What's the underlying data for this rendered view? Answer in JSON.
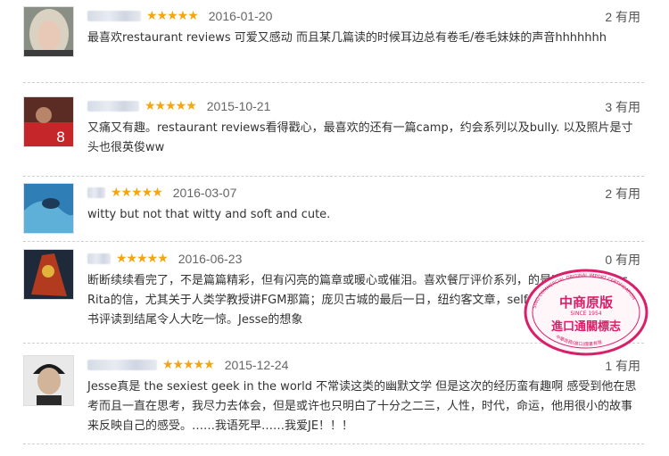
{
  "reviews": [
    {
      "stars": "★★★★★",
      "date": "2016-01-20",
      "helpful": "2 有用",
      "text": "最喜欢restaurant reviews 可爱又感动 而且某几篇读的时候耳边总有卷毛/卷毛妹妹的声音hhhhhhh"
    },
    {
      "stars": "★★★★★",
      "date": "2015-10-21",
      "helpful": "3 有用",
      "text": "又痛又有趣。restaurant reviews看得戳心，最喜欢的还有一篇camp，约会系列以及bully. 以及照片是寸头也很英俊ww"
    },
    {
      "stars": "★★★★★",
      "date": "2016-03-07",
      "helpful": "2 有用",
      "text": "witty but not that witty and soft and cute."
    },
    {
      "stars": "★★★★★",
      "date": "2016-06-23",
      "helpful": "0 有用",
      "text": "断断续续看完了，不是篇篇精彩，但有闪亮的篇章或暖心或催泪。喜欢餐厅评价系列，的是Harper给Miss Rita的信，尤其关于人类学教授讲FGM那篇；庞贝古城的最后一日，纽约客文章，self help部分里的一篇书评读到结尾令人大吃一惊。Jesse的想象"
    },
    {
      "stars": "★★★★★",
      "date": "2015-12-24",
      "helpful": "1 有用",
      "text": "Jesse真是 the sexiest geek in the world 不常读这类的幽默文学 但是这次的经历蛮有趣啊 感受到他在思考而且一直在思考，我尽力去体会，但是或许也只明白了十分之二三，人性，时代，命运，他用很小的故事来反映自己的感受。……我语死早……我爱JE！！！"
    }
  ],
  "stamp": {
    "top_text": "SINO-COMMERCIAL ORIGINAL IMPORT CERTIFICATION",
    "line1": "中商原版",
    "line2": "進口通關標志",
    "since": "SINCE 1954",
    "bottom_text": "中華商務(進口)圖書有限"
  },
  "colors": {
    "star": "#f3a60e",
    "text": "#333333",
    "stamp": "#d8206a",
    "divider": "#cfcfcf"
  }
}
